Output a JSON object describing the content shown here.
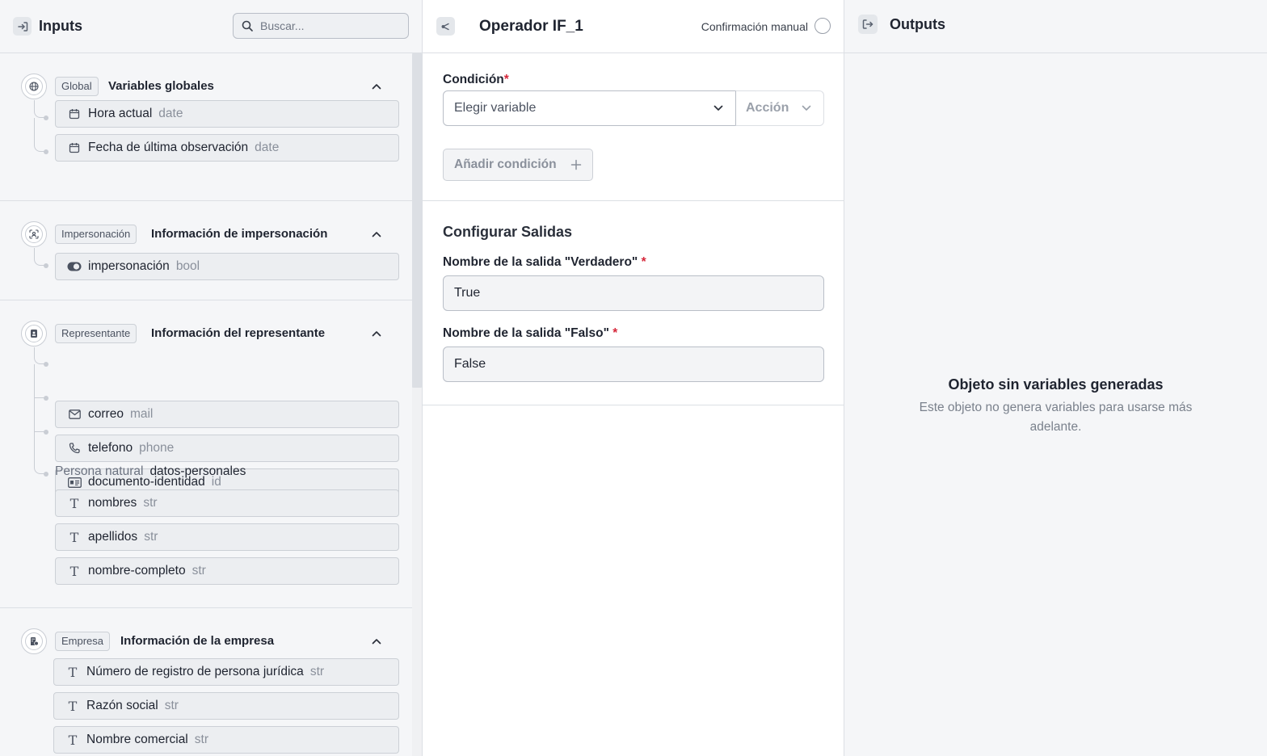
{
  "inputs": {
    "title": "Inputs",
    "search_placeholder": "Buscar...",
    "groups": [
      {
        "badge": "Global",
        "title": "Variables globales",
        "items": [
          {
            "icon": "calendar-icon",
            "name": "Hora actual",
            "type": "date"
          },
          {
            "icon": "calendar-icon",
            "name": "Fecha de última observación",
            "type": "date"
          }
        ]
      },
      {
        "badge": "Impersonación",
        "title": "Información de impersonación",
        "items": [
          {
            "icon": "toggle-icon",
            "name": "impersonación",
            "type": "bool"
          }
        ]
      },
      {
        "badge": "Representante",
        "title": "Información del representante",
        "items": [
          {
            "icon": "mail-icon",
            "name": "correo",
            "type": "mail"
          },
          {
            "icon": "phone-icon",
            "name": "telefono",
            "type": "phone"
          },
          {
            "icon": "id-card-icon",
            "name": "documento-identidad",
            "type": "id"
          }
        ],
        "subgroup": {
          "label": "Persona natural",
          "name": "datos-personales",
          "items": [
            {
              "icon": "text-icon",
              "name": "nombres",
              "type": "str"
            },
            {
              "icon": "text-icon",
              "name": "apellidos",
              "type": "str"
            },
            {
              "icon": "text-icon",
              "name": "nombre-completo",
              "type": "str"
            }
          ]
        }
      },
      {
        "badge": "Empresa",
        "title": "Información de la empresa",
        "items": [
          {
            "icon": "text-icon",
            "name": "Número de registro de persona jurídica",
            "type": "str"
          },
          {
            "icon": "text-icon",
            "name": "Razón social",
            "type": "str"
          },
          {
            "icon": "text-icon",
            "name": "Nombre comercial",
            "type": "str"
          }
        ]
      }
    ]
  },
  "center": {
    "title": "Operador IF_1",
    "manual_confirm_label": "Confirmación manual",
    "condition_label": "Condición",
    "required_mark": "*",
    "choose_variable": "Elegir variable",
    "action_label": "Acción",
    "add_condition": "Añadir condición",
    "outputs_section_title": "Configurar Salidas",
    "true_output_label": "Nombre de la salida \"Verdadero\"",
    "true_output_value": "True",
    "false_output_label": "Nombre de la salida \"Falso\"",
    "false_output_value": "False"
  },
  "outputs": {
    "title": "Outputs",
    "empty_title": "Objeto sin variables generadas",
    "empty_desc": "Este objeto no genera variables para usarse más adelante."
  },
  "colors": {
    "required": "#d6283b",
    "panel_bg": "#f5f6f8",
    "border": "#dcdfe4"
  }
}
